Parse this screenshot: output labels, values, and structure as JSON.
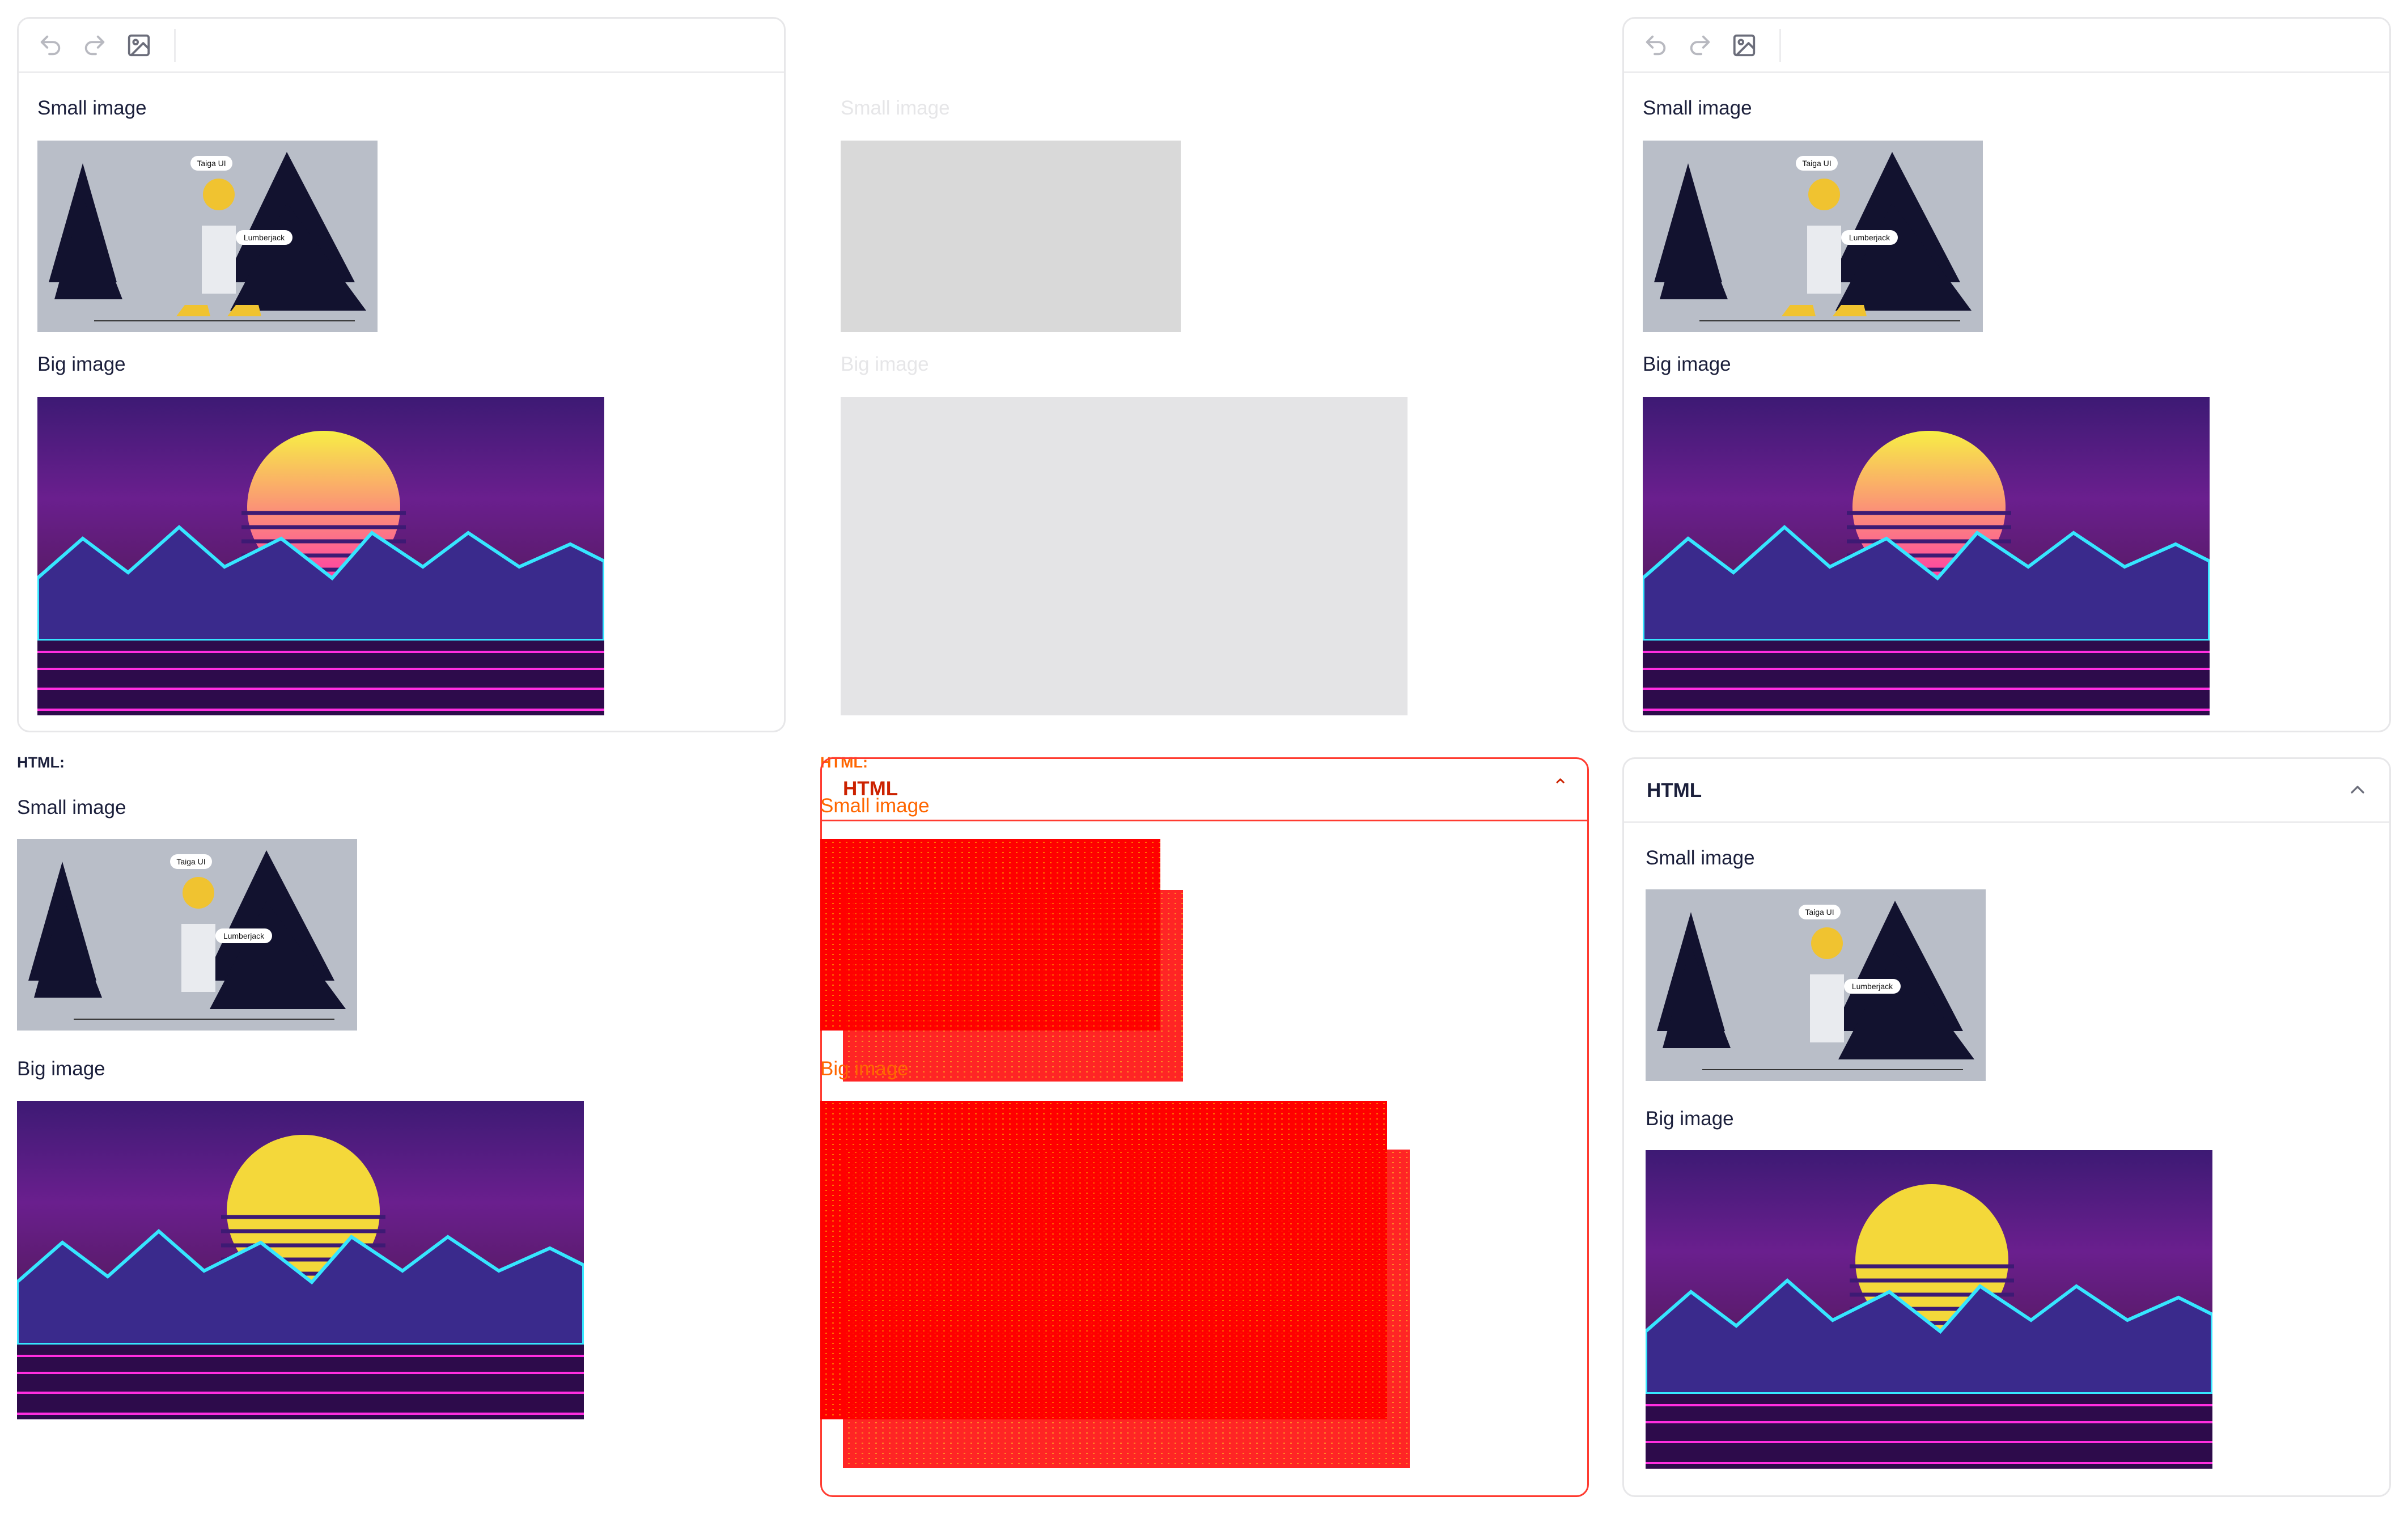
{
  "toolbar": {
    "undo_icon": "undo-icon",
    "redo_icon": "redo-icon",
    "image_icon": "image-icon"
  },
  "editor": {
    "small_image_label": "Small image",
    "big_image_label": "Big image",
    "small_image_alt": {
      "tag_taiga": "Taiga UI",
      "tag_lumberjack": "Lumberjack"
    }
  },
  "html_section": {
    "label": "HTML:",
    "small_image_label": "Small image",
    "big_image_label": "Big image"
  },
  "accordion": {
    "title": "HTML",
    "chevron_icon": "chevron-up-icon",
    "small_image_label": "Small image",
    "big_image_label": "Big image"
  },
  "colors": {
    "border": "#e7e7e9",
    "text": "#1b1f3b",
    "debug_red": "#ff0000",
    "debug_orange": "#ff6600"
  }
}
